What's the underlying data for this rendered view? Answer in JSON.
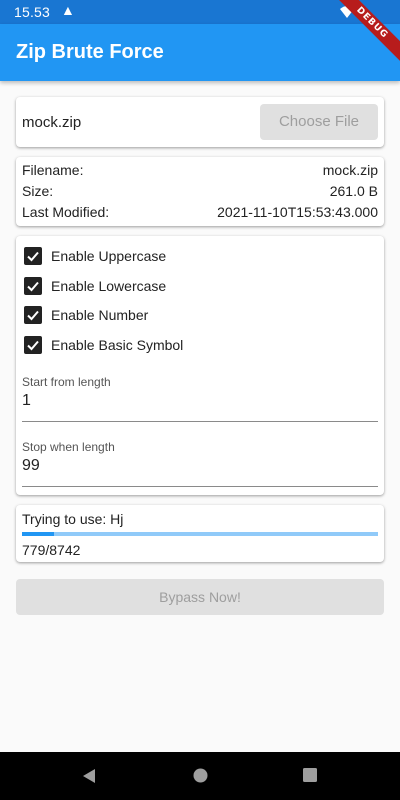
{
  "status_bar": {
    "time": "15.53",
    "icons": [
      "warning-icon",
      "wifi-icon"
    ]
  },
  "debug_banner": "DEBUG",
  "app_bar": {
    "title": "Zip Brute Force"
  },
  "file_picker": {
    "selected_file": "mock.zip",
    "choose_label": "Choose File"
  },
  "file_info": {
    "rows": [
      {
        "label": "Filename:",
        "value": "mock.zip"
      },
      {
        "label": "Size:",
        "value": "261.0 B"
      },
      {
        "label": "Last Modified:",
        "value": "2021-11-10T15:53:43.000"
      }
    ]
  },
  "options": {
    "checkboxes": [
      {
        "label": "Enable Uppercase",
        "checked": true
      },
      {
        "label": "Enable Lowercase",
        "checked": true
      },
      {
        "label": "Enable Number",
        "checked": true
      },
      {
        "label": "Enable Basic Symbol",
        "checked": true
      }
    ],
    "start_length": {
      "label": "Start from length",
      "value": "1"
    },
    "stop_length": {
      "label": "Stop when length",
      "value": "99"
    }
  },
  "progress": {
    "trying_text": "Trying to use: Hj",
    "count_text": "779/8742",
    "current": 779,
    "total": 8742,
    "fraction": 0.089
  },
  "bypass_label": "Bypass Now!",
  "colors": {
    "primary": "#2196f3",
    "status_bar": "#1976d2",
    "progress_track": "#90caf9",
    "disabled_button": "#e0e0e0",
    "debug_ribbon": "#b71c1c"
  },
  "nav_bar": {
    "icons": [
      "back-icon",
      "home-icon",
      "recents-icon"
    ]
  }
}
